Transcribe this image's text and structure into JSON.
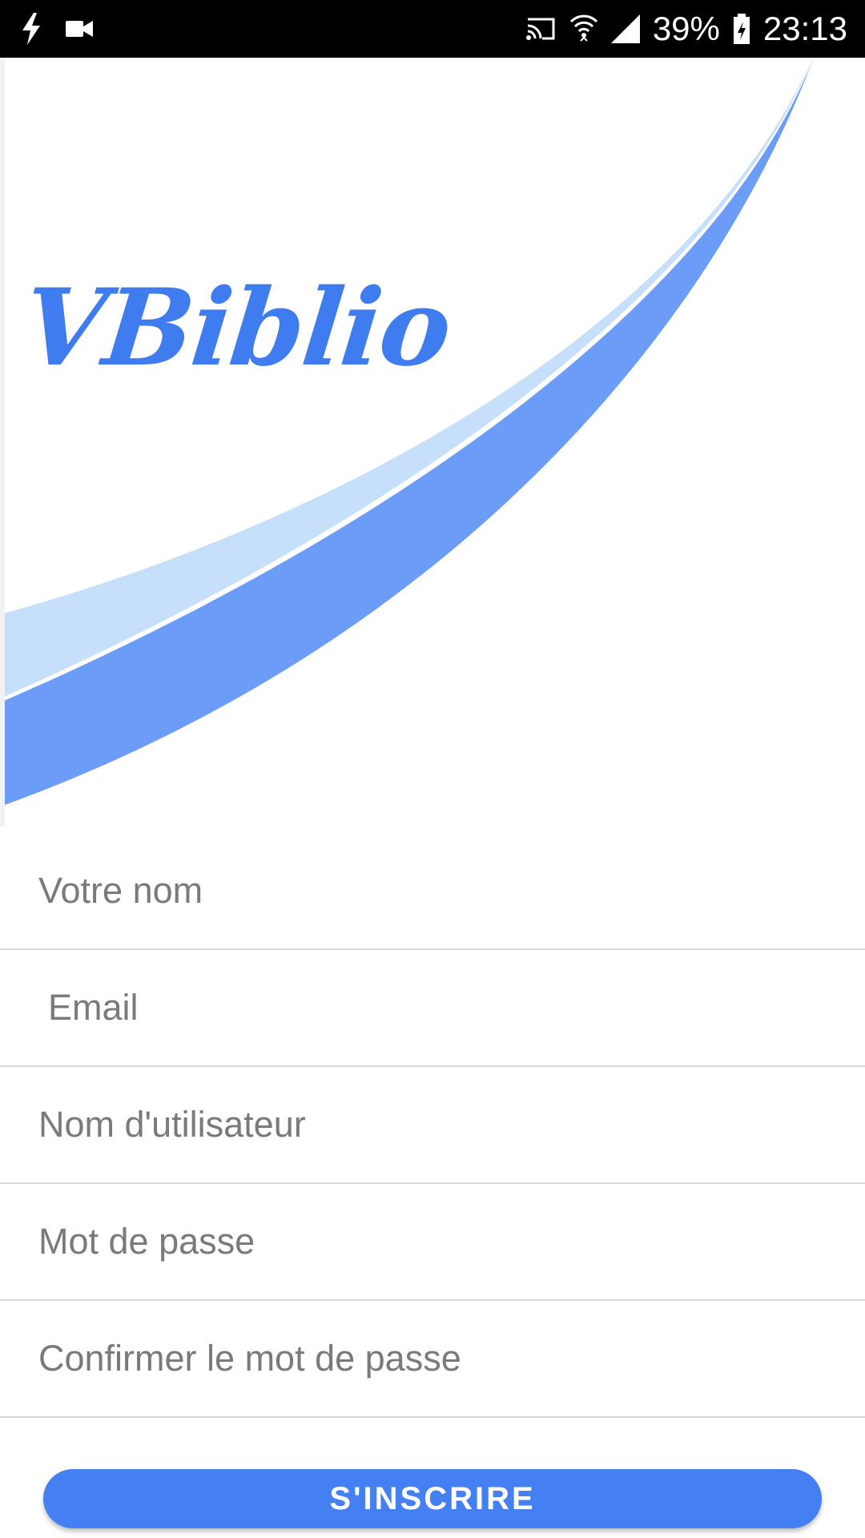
{
  "status_bar": {
    "icons_left": [
      "flash-icon",
      "video-camera-icon"
    ],
    "icons_right": [
      "cast-icon",
      "wifi-icon",
      "signal-icon",
      "battery-charging-icon"
    ],
    "battery": "39%",
    "time": "23:13"
  },
  "app": {
    "logo_text": "VBiblio",
    "accent_color": "#4480f2",
    "swoosh_dark": "#6a9cf8",
    "swoosh_light": "#c6e0fb"
  },
  "form": {
    "name_placeholder": "Votre nom",
    "email_placeholder": "Email",
    "username_placeholder": "Nom d'utilisateur",
    "password_placeholder": "Mot de passe",
    "confirm_placeholder": "Confirmer le mot de passe",
    "submit_label": "S'INSCRIRE"
  }
}
